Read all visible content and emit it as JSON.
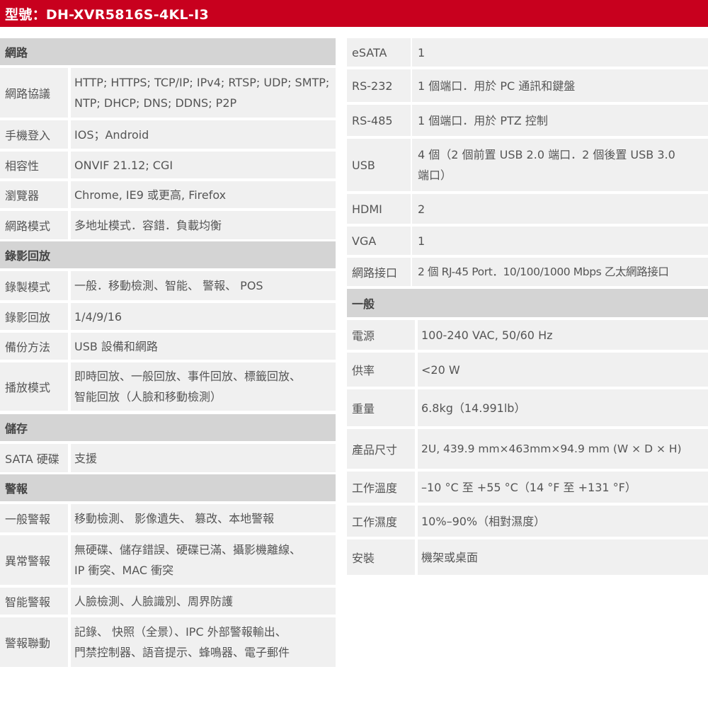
{
  "header": {
    "title": "型號：DH-XVR5816S-4KL-I3",
    "color": "#c8001e"
  },
  "left": {
    "network": {
      "section": "網路",
      "rows": [
        {
          "label": "網路協議",
          "value": "HTTP; HTTPS; TCP/IP; IPv4; RTSP; UDP; SMTP;\nNTP; DHCP; DNS; DDNS; P2P"
        },
        {
          "label": "手機登入",
          "value": "IOS；Android"
        },
        {
          "label": "相容性",
          "value": "ONVIF 21.12; CGI"
        },
        {
          "label": "瀏覽器",
          "value": "Chrome, IE9 或更高, Firefox"
        },
        {
          "label": "網路模式",
          "value": "多地址模式．容錯．負載均衡"
        }
      ]
    },
    "playback": {
      "section": "錄影回放",
      "rows": [
        {
          "label": "錄製模式",
          "value": "一般．移動檢測、智能、 警報、 POS"
        },
        {
          "label": "錄影回放",
          "value": "1/4/9/16"
        },
        {
          "label": "備份方法",
          "value": "USB 設備和網路"
        },
        {
          "label": "播放模式",
          "value": "即時回放、一般回放、事件回放、標籤回放、\n智能回放（人臉和移動檢測）"
        }
      ]
    },
    "storage": {
      "section": "儲存",
      "rows": [
        {
          "label": "SATA 硬碟",
          "value": "支援"
        }
      ]
    },
    "alarm": {
      "section": "警報",
      "rows": [
        {
          "label": "一般警報",
          "value": "移動檢測、 影像遺失、 篡改、本地警報"
        },
        {
          "label": "異常警報",
          "value": "無硬碟、儲存錯誤、硬碟已滿、攝影機離線、\nIP 衝突、MAC 衝突"
        },
        {
          "label": "智能警報",
          "value": "人臉檢測、人臉識別、周界防護"
        },
        {
          "label": "警報聯動",
          "value": "記錄、 快照（全景）、IPC 外部警報輸出、\n門禁控制器、語音提示、蜂鳴器、電子郵件"
        }
      ]
    }
  },
  "right": {
    "interface": {
      "rows": [
        {
          "label": "eSATA",
          "value": "1"
        },
        {
          "label": "RS-232",
          "value": "1 個端口．用於 PC 通訊和鍵盤"
        },
        {
          "label": "RS-485",
          "value": "1 個端口．用於 PTZ  控制"
        },
        {
          "label": "USB",
          "value": "4  個（2 個前置 USB 2.0 端口．2 個後置 USB 3.0\n端口）"
        },
        {
          "label": "HDMI",
          "value": "2"
        },
        {
          "label": "VGA",
          "value": "1"
        },
        {
          "label": "網路接口",
          "value": "2 個 RJ-45 Port．10/100/1000 Mbps 乙太網路接口"
        }
      ]
    },
    "general": {
      "section": "一般",
      "rows": [
        {
          "label": "電源",
          "value": "100-240 VAC, 50/60 Hz"
        },
        {
          "label": "供率",
          "value": "<20 W"
        },
        {
          "label": "重量",
          "value": "6.8kg（14.991lb）"
        },
        {
          "label": "產品尺寸",
          "value": "2U, 439.9 mm×463mm×94.9 mm (W × D × H)"
        },
        {
          "label": "工作溫度",
          "value": "–10 °C  至  +55 °C（14 °F  至  +131 °F）"
        },
        {
          "label": "工作濕度",
          "value": "10%–90%（相對濕度）"
        },
        {
          "label": "安裝",
          "value": "機架或桌面"
        }
      ]
    }
  }
}
